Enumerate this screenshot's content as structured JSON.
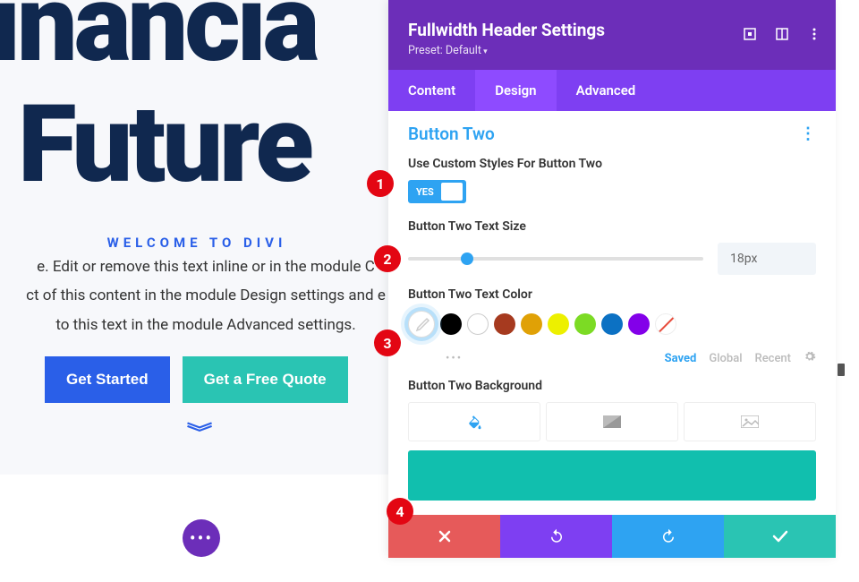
{
  "page": {
    "title_line1": "inancia",
    "title_line2": "Future",
    "welcome": "Welcome to Divi",
    "body": "e. Edit or remove this text inline or in the module C\nct of this content in the module Design settings and e\nto this text in the module Advanced settings.",
    "btn_primary": "Get Started",
    "btn_secondary": "Get a Free Quote"
  },
  "panel": {
    "title": "Fullwidth Header Settings",
    "subtitle": "Preset: Default",
    "tabs": {
      "content": "Content",
      "design": "Design",
      "advanced": "Advanced"
    },
    "section": "Button Two",
    "custom_styles_label": "Use Custom Styles For Button Two",
    "toggle_value": "YES",
    "text_size_label": "Button Two Text Size",
    "text_size_value": "18px",
    "text_color_label": "Button Two Text Color",
    "palette_links": {
      "saved": "Saved",
      "global": "Global",
      "recent": "Recent"
    },
    "bg_label": "Button Two Background",
    "colors": {
      "black": "#000000",
      "white_outline": "#ffffff",
      "brown": "#a63a1f",
      "gold": "#e0a106",
      "yellow": "#edf000",
      "green": "#7cdb24",
      "blue": "#0c71c3",
      "purple": "#8300e9"
    },
    "bg_preview": "#11bfae"
  },
  "badges": [
    "1",
    "2",
    "3",
    "4"
  ]
}
